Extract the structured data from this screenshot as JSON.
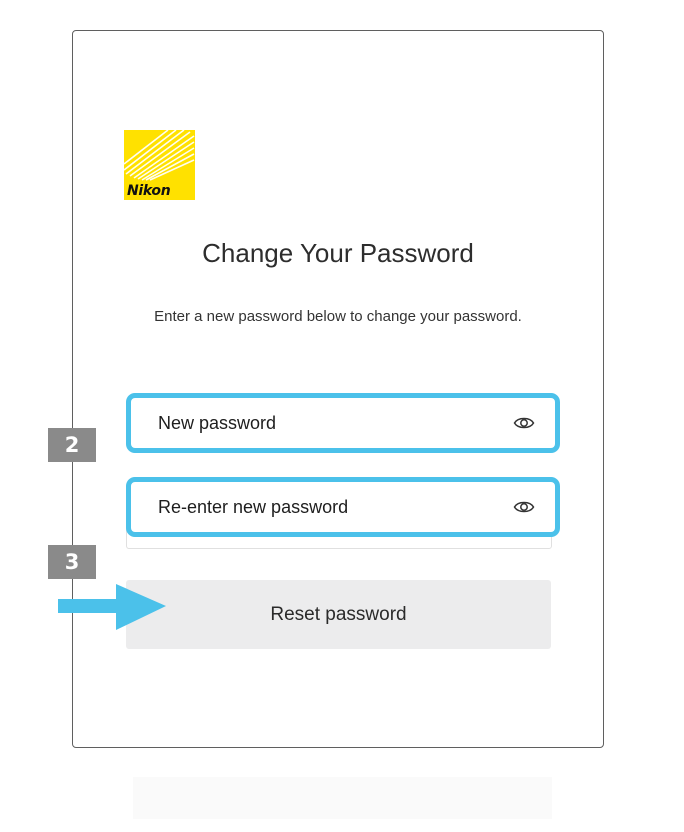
{
  "brand": {
    "logo_text": "Nikon",
    "logo_color": "#FFE100"
  },
  "form": {
    "title": "Change Your Password",
    "description": "Enter a new password below to change your password.",
    "new_password": {
      "placeholder": "New password",
      "value": "",
      "icon": "eye-icon"
    },
    "confirm_password": {
      "placeholder": "Re-enter new password",
      "value": "",
      "icon": "eye-icon"
    },
    "submit_label": "Reset password"
  },
  "annotations": {
    "step_2": "2",
    "step_3": "3",
    "highlight_color": "#4BC1EA",
    "badge_color": "#8A8A8A",
    "arrow_icon": "right-arrow-icon"
  }
}
